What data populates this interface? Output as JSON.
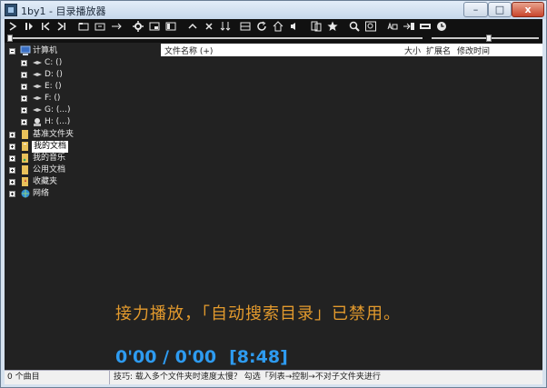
{
  "window": {
    "title": "1by1 - 目录播放器",
    "minimize_glyph": "–",
    "maximize_glyph": "□",
    "close_glyph": "x"
  },
  "toolbar": {
    "buttons": [
      {
        "name": "play-icon"
      },
      {
        "name": "pause-icon"
      },
      {
        "name": "previous-icon"
      },
      {
        "name": "next-icon"
      },
      {
        "name": "open-folder-icon"
      },
      {
        "name": "new-folder-icon"
      },
      {
        "name": "arrow-right-icon"
      },
      {
        "name": "gear-icon"
      },
      {
        "name": "window-icon"
      },
      {
        "name": "panel-icon"
      },
      {
        "name": "up-icon"
      },
      {
        "name": "close-icon"
      },
      {
        "name": "sort-icon"
      },
      {
        "name": "list-view-icon"
      },
      {
        "name": "refresh-icon"
      },
      {
        "name": "home-icon"
      },
      {
        "name": "speaker-icon"
      },
      {
        "name": "copy-icon"
      },
      {
        "name": "star-icon"
      },
      {
        "name": "search-icon"
      },
      {
        "name": "find-icon"
      },
      {
        "name": "ab-repeat-icon"
      },
      {
        "name": "arrow-into-icon"
      },
      {
        "name": "bitrate-icon"
      },
      {
        "name": "clock-icon"
      }
    ]
  },
  "seek": {
    "position_fraction": 0.0
  },
  "volume": {
    "level_fraction": 0.5
  },
  "tree": {
    "computer_label": "计算机",
    "drives": [
      "C: ()",
      "D: ()",
      "E: ()",
      "F: ()",
      "G: (...)",
      "H: (...)"
    ],
    "folders": [
      "基准文件夹",
      "我的文档",
      "我的音乐",
      "公用文档",
      "收藏夹",
      "网络"
    ],
    "selected_folder": "我的文档"
  },
  "list": {
    "col_name": "文件名称 (+)",
    "col_size": "大小",
    "col_ext": "扩展名",
    "col_modified": "修改时间"
  },
  "player": {
    "message": "接力播放，「自动搜索目录」已禁用。",
    "time": "0'00 / 0'00",
    "total": "[8:48]"
  },
  "status": {
    "count": "0 个曲目",
    "tip": "技巧: 载入多个文件夹时速度太慢？ 勾选「列表→控制→不对子文件夹进行"
  },
  "colors": {
    "accent_orange": "#e39a2d",
    "accent_blue": "#2e9bf0",
    "panel_bg": "#222222"
  }
}
